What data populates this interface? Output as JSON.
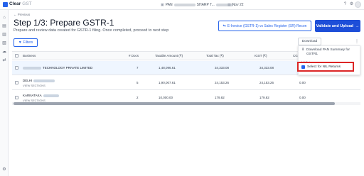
{
  "app": {
    "brand": "Clear",
    "product": "GST"
  },
  "topbar": {
    "pan_label": "PAN",
    "pan_partial": "SHARP T...",
    "period": "Nov 22"
  },
  "page": {
    "back_label": "← Previous",
    "title": "Step 1/3: Prepare GSTR-1",
    "description": "Prepare and review data created for GSTR-1 filing. Once completed, proceed to next step"
  },
  "actions": {
    "recon_label": "E-Invoice (GSTR-1) vs Sales Register (SR) Recon",
    "validate_label": "Validate and Upload",
    "filters_label": "Filters",
    "download_label": "Download"
  },
  "table": {
    "headers": [
      "Business",
      "# Docs",
      "Taxable Amount (₹)",
      "Total Tax (₹)",
      "IGST (₹)",
      "CGS"
    ],
    "rows": [
      {
        "name": "TECHNOLOGY PRIVATE LIMITED",
        "sub": "",
        "docs": "7",
        "taxable": "1,48,096.61",
        "total_tax": "34,333.08",
        "igst": "34,333.08",
        "cgst": "",
        "selected": true
      },
      {
        "name": "DELHI",
        "sub": "VIEW SECTIONS",
        "docs": "5",
        "taxable": "1,90,007.61",
        "total_tax": "24,153.26",
        "igst": "24,153.26",
        "cgst": "0.00",
        "selected": false
      },
      {
        "name": "KARNATAKA",
        "sub": "VIEW SECTIONS",
        "docs": "2",
        "taxable": "10,000.00",
        "total_tax": "179.82",
        "igst": "179.82",
        "cgst": "0.00",
        "selected": false
      }
    ]
  },
  "dropdown": {
    "item_pan_summary": "Download PAN Summary for GSTR1",
    "section_label": "Nil Returns",
    "item_nil": "Select for NIL Returns"
  }
}
